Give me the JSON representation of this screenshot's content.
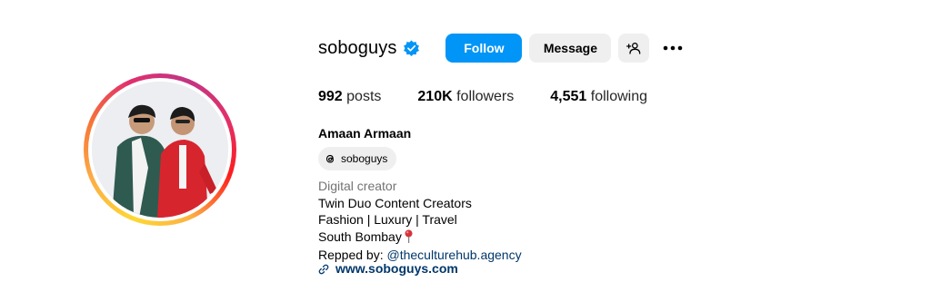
{
  "profile": {
    "username": "soboguys",
    "verified": true,
    "buttons": {
      "follow": "Follow",
      "message": "Message"
    },
    "stats": {
      "posts_count": "992",
      "posts_label": "posts",
      "followers_count": "210K",
      "followers_label": "followers",
      "following_count": "4,551",
      "following_label": "following"
    },
    "display_name": "Amaan Armaan",
    "threads_handle": "soboguys",
    "bio": {
      "category": "Digital creator",
      "line1": "Twin Duo Content Creators",
      "line2": "Fashion | Luxury | Travel",
      "line3": "South Bombay",
      "repped_prefix": "Repped by:",
      "repped_handle": "@theculturehub.agency"
    },
    "website": "www.soboguys.com"
  },
  "colors": {
    "accent": "#0095f6",
    "verified_badge": "#0095f6",
    "link": "#00376b",
    "category_text": "#737373",
    "button_secondary": "#efefef"
  },
  "icons": {
    "verified": "verified-badge-icon",
    "add_user": "add-user-icon",
    "more": "more-options-icon",
    "threads": "threads-icon",
    "location_pin": "location-pin-icon",
    "link": "link-icon"
  }
}
